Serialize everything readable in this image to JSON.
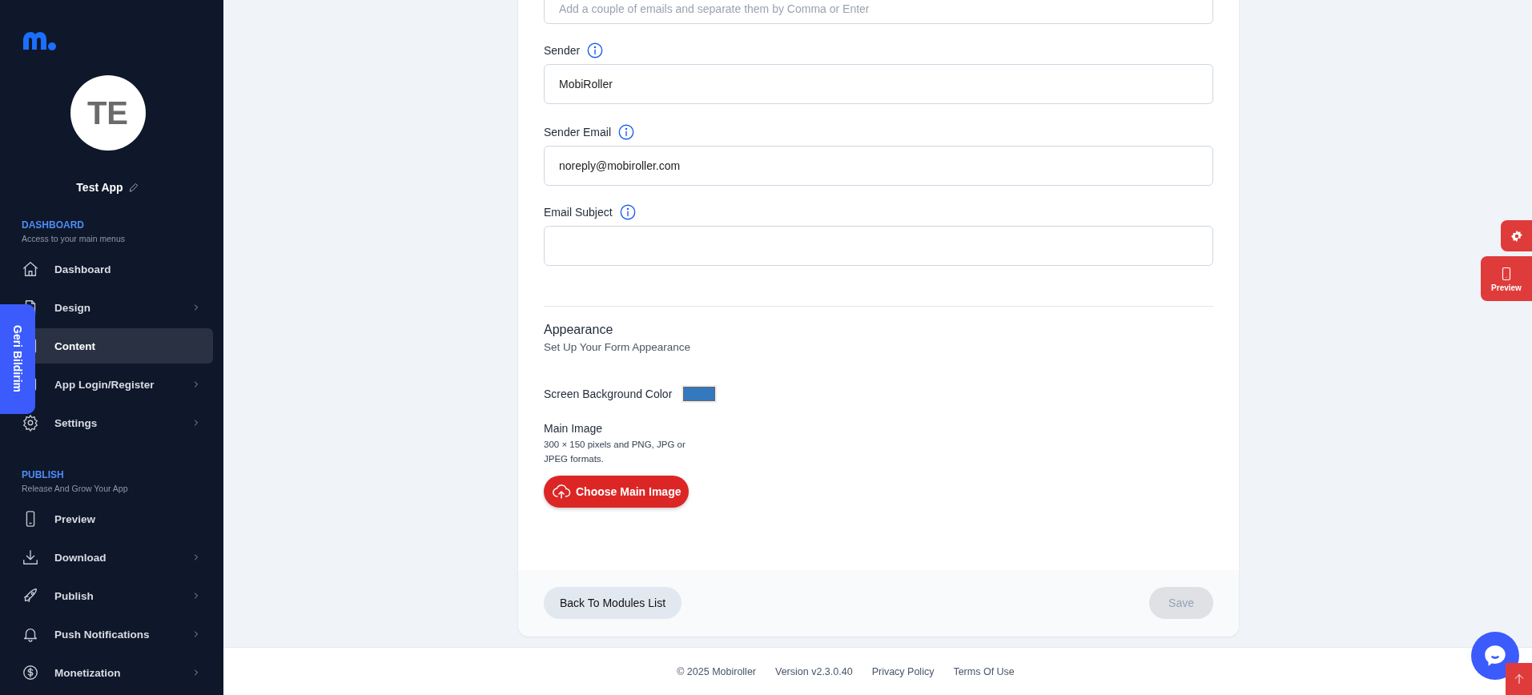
{
  "sidebar": {
    "avatar": {
      "initials": "TE"
    },
    "app_name": "Test App",
    "sections": [
      {
        "title": "DASHBOARD",
        "subtitle": "Access to your main menus",
        "items": [
          {
            "label": "Dashboard",
            "selected": false,
            "submenu": false
          },
          {
            "label": "Design",
            "selected": false,
            "submenu": true
          },
          {
            "label": "Content",
            "selected": true,
            "submenu": false
          },
          {
            "label": "App Login/Register",
            "selected": false,
            "submenu": true
          },
          {
            "label": "Settings",
            "selected": false,
            "submenu": true
          }
        ]
      },
      {
        "title": "PUBLISH",
        "subtitle": "Release And Grow Your App",
        "items": [
          {
            "label": "Preview",
            "selected": false,
            "submenu": false
          },
          {
            "label": "Download",
            "selected": false,
            "submenu": true
          },
          {
            "label": "Publish",
            "selected": false,
            "submenu": true
          },
          {
            "label": "Push Notifications",
            "selected": false,
            "submenu": true
          },
          {
            "label": "Monetization",
            "selected": false,
            "submenu": true
          }
        ]
      }
    ]
  },
  "feedback_tab": {
    "label": "Geri Bildirim"
  },
  "form": {
    "fields": [
      {
        "placeholder": "Add a couple of emails and separate them by Comma or Enter"
      },
      {
        "label": "Sender",
        "info": true,
        "value": "MobiRoller"
      },
      {
        "label": "Sender Email",
        "info": true,
        "value": "noreply@mobiroller.com"
      },
      {
        "label": "Email Subject",
        "info": true
      }
    ],
    "appearance": {
      "title": "Appearance",
      "subtitle": "Set Up Your Form Appearance",
      "color_setting": {
        "label": "Screen Background Color",
        "color": "#3478bd"
      },
      "main_image": {
        "label": "Main Image",
        "description": "300 × 150 pixels and PNG, JPG or JPEG formats.",
        "button": "Choose Main Image"
      }
    },
    "actions": {
      "back": "Back To Modules List",
      "save": {
        "label": "Save",
        "disabled": true
      }
    }
  },
  "right_tools": {
    "preview": "Preview"
  },
  "footer": {
    "items": [
      "© 2025 Mobiroller",
      "Version v2.3.0.40",
      "Privacy Policy",
      "Terms Of Use"
    ]
  }
}
